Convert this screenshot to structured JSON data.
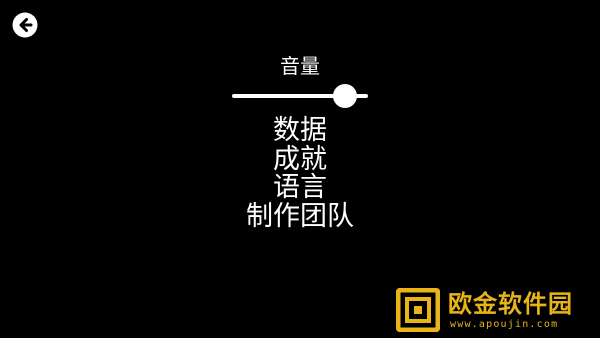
{
  "header": {
    "back_icon": "back-arrow-icon"
  },
  "volume": {
    "label": "音量",
    "level": 0.83
  },
  "menu": {
    "items": [
      {
        "label": "数据"
      },
      {
        "label": "成就"
      },
      {
        "label": "语言"
      },
      {
        "label": "制作团队"
      }
    ]
  },
  "watermark": {
    "title": "欧金软件园",
    "url": "www.apoujin.com",
    "color": "#e8b418"
  }
}
